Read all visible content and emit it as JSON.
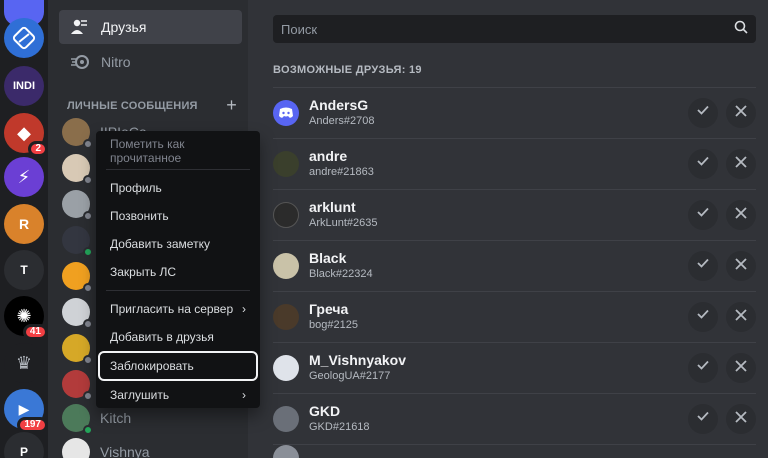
{
  "nav": {
    "friends_label": "Друзья",
    "nitro_label": "Nitro"
  },
  "dms": {
    "header": "ЛИЧНЫЕ СООБЩЕНИЯ",
    "add_symbol": "+",
    "items": [
      {
        "name": "IIPIoCo",
        "status": "offline"
      },
      {
        "name": "",
        "status": "offline"
      },
      {
        "name": "",
        "status": "offline"
      },
      {
        "name": "",
        "status": "online"
      },
      {
        "name": "",
        "status": "offline"
      },
      {
        "name": "",
        "status": "offline"
      },
      {
        "name": "",
        "status": "offline"
      },
      {
        "name": "",
        "status": "offline"
      },
      {
        "name": "Kitch",
        "status": "online"
      },
      {
        "name": "Vishnya",
        "status": "offline"
      }
    ]
  },
  "servers": {
    "badges": [
      "2",
      "41",
      "197"
    ],
    "letters": [
      "T",
      "P"
    ]
  },
  "search": {
    "placeholder": "Поиск"
  },
  "section": {
    "title": "ВОЗМОЖНЫЕ ДРУЗЬЯ: 19"
  },
  "friends": [
    {
      "name": "AndersG",
      "tag": "Anders#2708",
      "avatar_color": "#5865f2"
    },
    {
      "name": "andre",
      "tag": "andre#21863",
      "avatar_color": "#3a3f2c"
    },
    {
      "name": "arklunt",
      "tag": "ArkLunt#2635",
      "avatar_color": "#2b2b2b"
    },
    {
      "name": "Black",
      "tag": "Black#22324",
      "avatar_color": "#c9c2a8"
    },
    {
      "name": "Греча",
      "tag": "bog#2125",
      "avatar_color": "#4a3a2a"
    },
    {
      "name": "M_Vishnyakov",
      "tag": "GeologUA#2177",
      "avatar_color": "#dfe3ea"
    },
    {
      "name": "GKD",
      "tag": "GKD#21618",
      "avatar_color": "#6a6f78"
    }
  ],
  "menu": {
    "mark_read": "Пометить как прочитанное",
    "profile": "Профиль",
    "call": "Позвонить",
    "add_note": "Добавить заметку",
    "close_dm": "Закрыть ЛС",
    "invite": "Пригласить на сервер",
    "add_friend": "Добавить в друзья",
    "block": "Заблокировать",
    "mute": "Заглушить",
    "arrow": "›"
  },
  "colors": {
    "accent": "#5865f2",
    "online": "#23a55a",
    "danger": "#f23f43"
  }
}
